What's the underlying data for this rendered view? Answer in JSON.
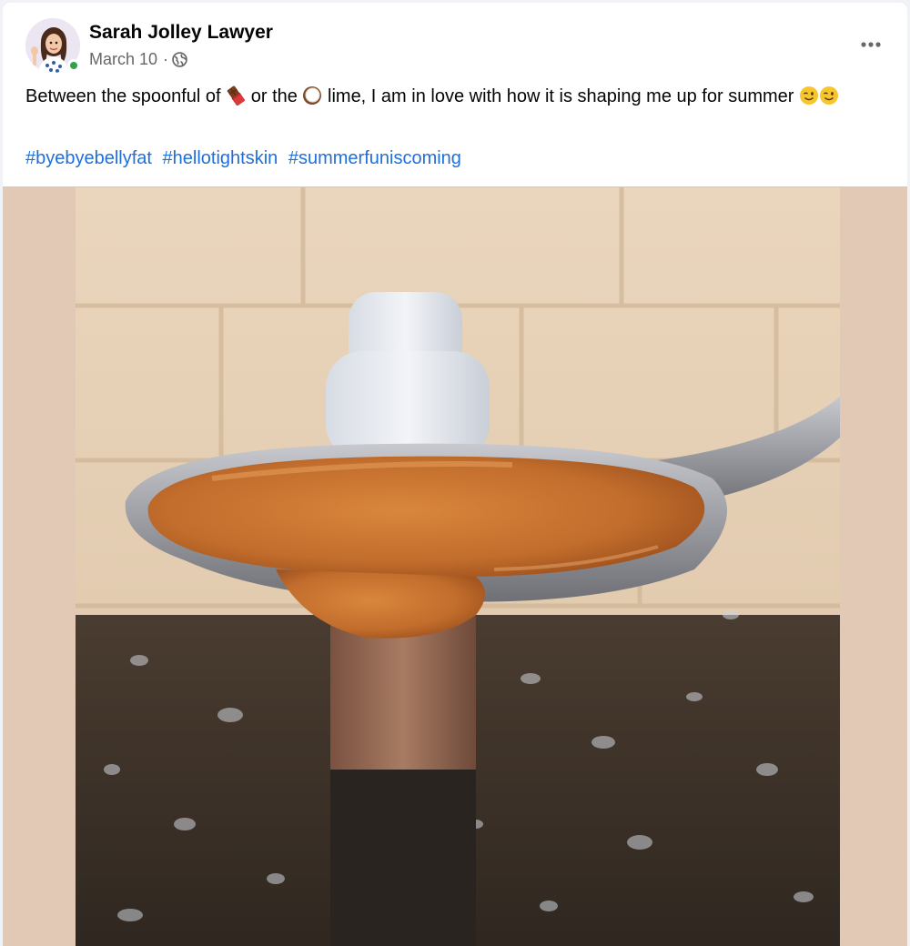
{
  "post": {
    "author": {
      "name": "Sarah Jolley Lawyer",
      "avatar_icon": "bitmoji-avatar",
      "online": true
    },
    "meta": {
      "date": "March 10",
      "separator": "·",
      "audience_icon": "globe-icon"
    },
    "more_icon": "ellipsis-icon",
    "text": {
      "part1": "Between the spoonful of",
      "emoji1": "chocolate-bar-emoji",
      "part2": "or the",
      "emoji2": "coconut-emoji",
      "part3": "lime, I am in love with how it is shaping me up for summer",
      "trailing_emojis": [
        "winking-face-emoji",
        "winking-face-emoji"
      ]
    },
    "hashtags": [
      "#byebyebellyfat",
      "#hellotightskin",
      "#summerfuniscoming"
    ],
    "photo": {
      "subject": "photo-spoon-with-syrup",
      "colors": {
        "side_panels": "#e1c9b6",
        "tile_wall": "#e8d2b8",
        "countertop": "#3b3128",
        "syrup": "#c8732f",
        "spoon": "#9a9a9e"
      }
    },
    "colors": {
      "link": "#216fdb",
      "online": "#31a24c",
      "meta_text": "#65676b"
    }
  }
}
